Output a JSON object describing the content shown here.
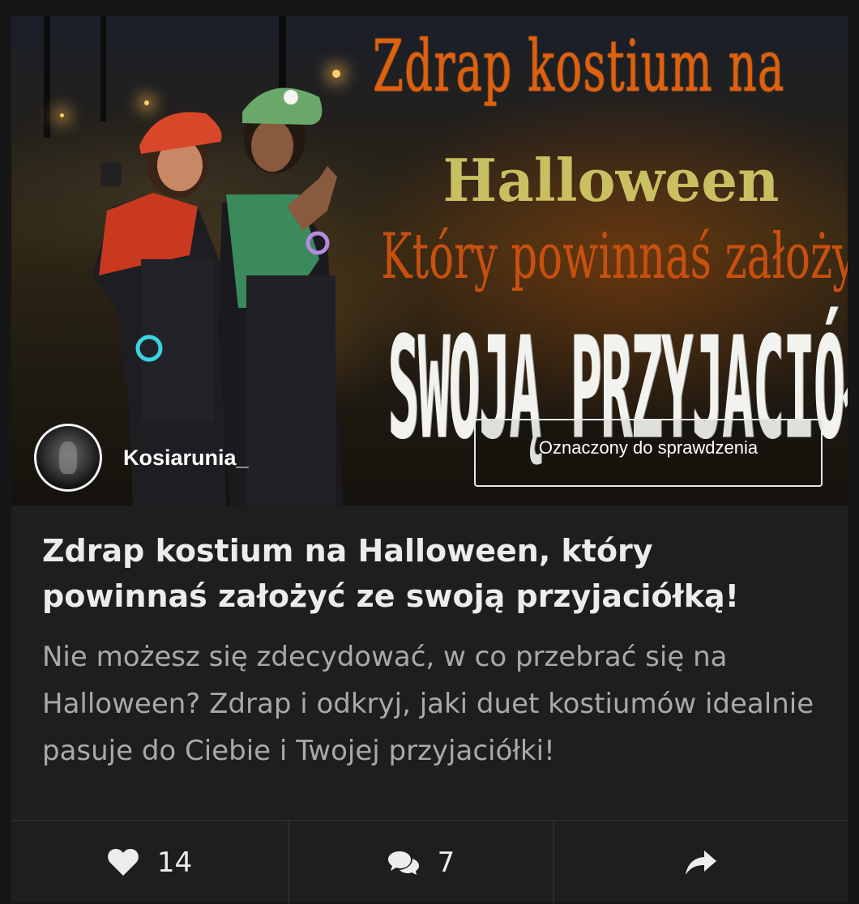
{
  "post": {
    "cover_text": {
      "line1": "Zdrap kostium na",
      "line2": "Halloween",
      "line3": "Który powinnaś założyć ze",
      "line4": "SWOJĄ PRZYJACIÓŁKĄ!"
    },
    "author": {
      "name": "Kosiarunia_"
    },
    "flag_label": "Oznaczony do sprawdzenia",
    "title": "Zdrap kostium na Halloween, który powinnaś założyć ze swoją przyjaciółką!",
    "description": "Nie możesz się zdecydować, w co przebrać się na Halloween? Zdrap i odkryj, jaki duet kostiumów idealnie pasuje do Ciebie i Twojej przyjaciółki!"
  },
  "actions": {
    "like": {
      "icon": "heart-icon",
      "count": "14"
    },
    "comment": {
      "icon": "comment-icon",
      "count": "7"
    },
    "share": {
      "icon": "share-icon"
    }
  },
  "colors": {
    "background": "#161616",
    "card": "#1e1e1e",
    "title": "#ececec",
    "description": "#a9a9a9",
    "cover_orange": "#e0600d",
    "cover_yellow": "#d8d06a"
  }
}
